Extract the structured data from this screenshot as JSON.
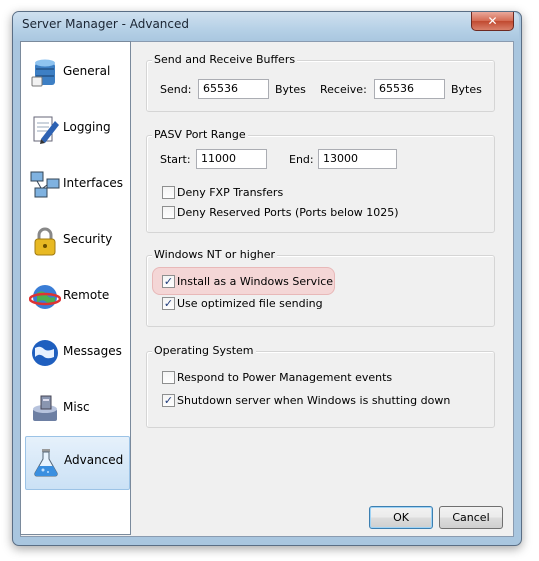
{
  "window": {
    "title": "Server Manager - Advanced",
    "close_glyph": "✕"
  },
  "sidebar": {
    "items": [
      {
        "label": "General",
        "icon": "database-icon",
        "selected": false
      },
      {
        "label": "Logging",
        "icon": "notepad-icon",
        "selected": false
      },
      {
        "label": "Interfaces",
        "icon": "network-icon",
        "selected": false
      },
      {
        "label": "Security",
        "icon": "padlock-icon",
        "selected": false
      },
      {
        "label": "Remote",
        "icon": "remote-globe-icon",
        "selected": false
      },
      {
        "label": "Messages",
        "icon": "globe-icon",
        "selected": false
      },
      {
        "label": "Misc",
        "icon": "server-disk-icon",
        "selected": false
      },
      {
        "label": "Advanced",
        "icon": "flask-icon",
        "selected": true
      }
    ]
  },
  "buffers": {
    "title": "Send and Receive Buffers",
    "send_label": "Send:",
    "send_value": "65536",
    "send_unit": "Bytes",
    "receive_label": "Receive:",
    "receive_value": "65536",
    "receive_unit": "Bytes"
  },
  "pasv": {
    "title": "PASV Port Range",
    "start_label": "Start:",
    "start_value": "11000",
    "end_label": "End:",
    "end_value": "13000",
    "deny_fxp": {
      "label": "Deny FXP Transfers",
      "checked": false
    },
    "deny_reserved": {
      "label": "Deny Reserved Ports (Ports below 1025)",
      "checked": false
    }
  },
  "winnt": {
    "title": "Windows NT or higher",
    "install_service": {
      "label": "Install as a Windows Service",
      "checked": true
    },
    "optimized_send": {
      "label": "Use optimized file sending",
      "checked": true
    }
  },
  "os": {
    "title": "Operating System",
    "power_mgmt": {
      "label": "Respond to Power Management events",
      "checked": false
    },
    "shutdown": {
      "label": "Shutdown server when Windows is shutting down",
      "checked": true
    }
  },
  "buttons": {
    "ok": "OK",
    "cancel": "Cancel"
  },
  "colors": {
    "selection": "#cbe1f5",
    "highlight": "#f4d6d6",
    "frame": "#a9c6df"
  }
}
